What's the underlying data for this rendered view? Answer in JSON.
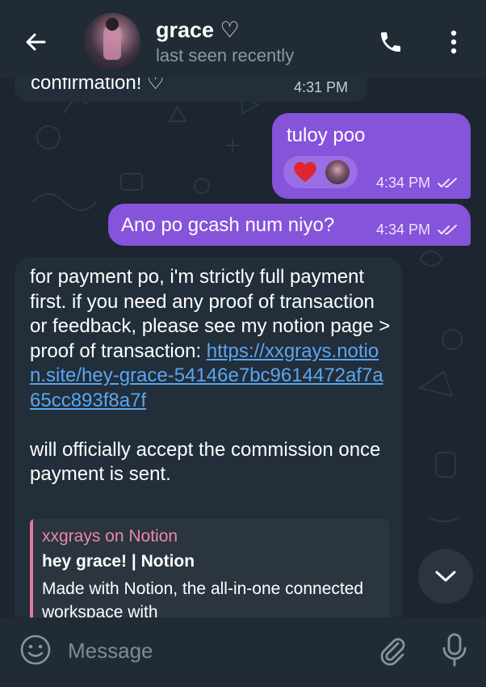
{
  "header": {
    "contact_name": "grace ♡",
    "status": "last seen recently"
  },
  "messages": [
    {
      "direction": "incoming",
      "text": "confirmation! ♡",
      "time": "4:31 PM"
    },
    {
      "direction": "outgoing",
      "text": "tuloy poo",
      "time": "4:34 PM",
      "reaction": "heart",
      "read": true
    },
    {
      "direction": "outgoing",
      "text": "Ano po gcash num niyo?",
      "time": "4:34 PM",
      "read": true
    },
    {
      "direction": "incoming",
      "text_part1": "for payment po, i'm strictly full payment first. if you need any proof of transaction or feedback, please see my notion page > proof of transaction: ",
      "link": "https://xxgrays.notion.site/hey-grace-54146e7bc9614472af7a65cc893f8a7f",
      "text_part2": "will officially accept the commission once payment is sent.",
      "preview": {
        "site": "xxgrays on Notion",
        "title": "hey grace! | Notion",
        "description": "Made with Notion, the all-in-one connected workspace with"
      }
    }
  ],
  "input": {
    "placeholder": "Message"
  },
  "colors": {
    "background": "#1c2530",
    "header": "#202b36",
    "incoming_bubble": "#222e3a",
    "outgoing_bubble": "#8653db",
    "link": "#5aa6f0",
    "preview_accent": "#e27a9e"
  },
  "icons": {
    "back": "arrow-left-icon",
    "call": "phone-icon",
    "menu": "more-vertical-icon",
    "scroll": "chevron-down-icon",
    "emoji": "smile-icon",
    "attach": "paperclip-icon",
    "mic": "microphone-icon",
    "read": "double-check-icon",
    "reaction": "heart-icon"
  }
}
